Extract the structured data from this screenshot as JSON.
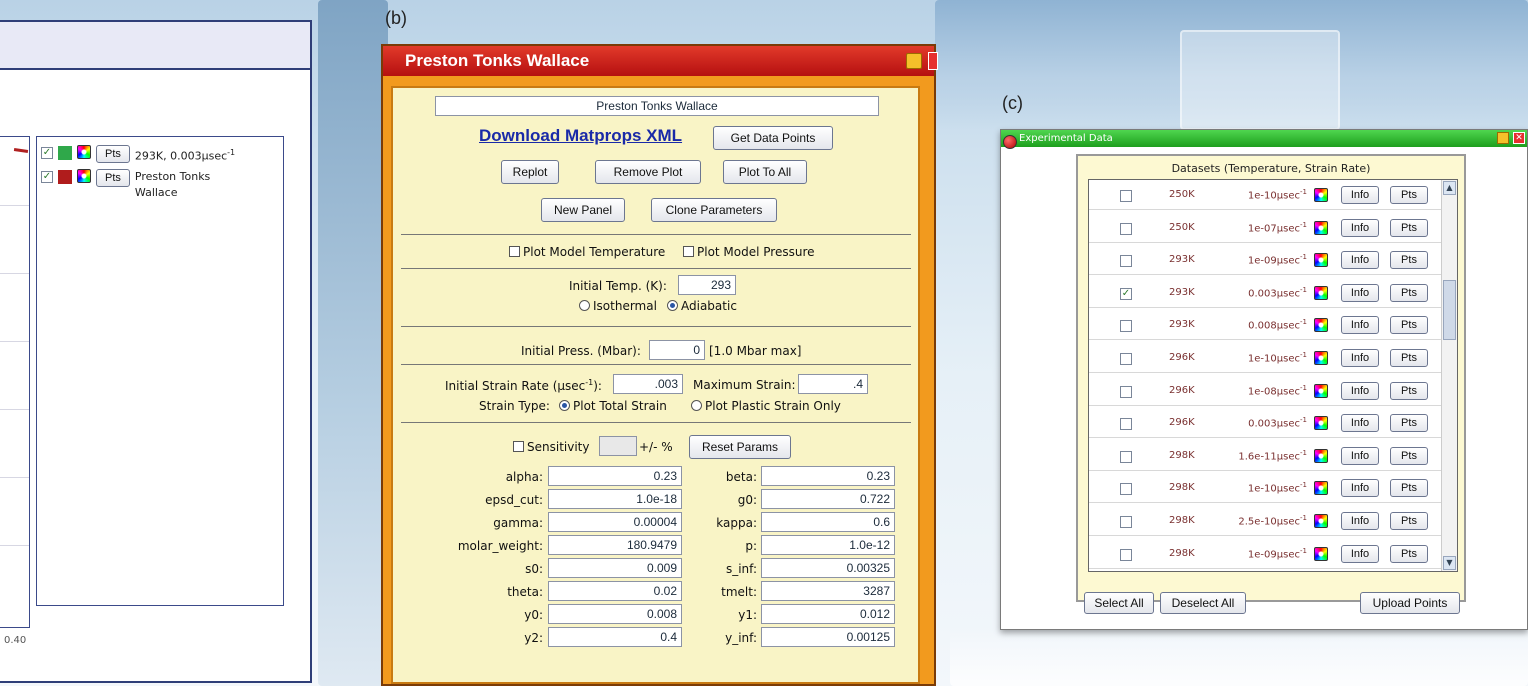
{
  "panel_labels": {
    "b": "(b)",
    "c": "(c)"
  },
  "panel_a": {
    "legend": [
      {
        "checked": true,
        "color": "#2fa84a",
        "pts_label": "Pts",
        "label": "293K, 0.003μsec",
        "sup": "-1"
      },
      {
        "checked": true,
        "color": "#b01c1c",
        "pts_label": "Pts",
        "label": "Preston Tonks Wallace",
        "sup": ""
      }
    ],
    "x_tick": "0.40"
  },
  "window_b": {
    "title": "Preston Tonks Wallace",
    "name_field": "Preston Tonks Wallace",
    "download_link": "Download Matprops XML",
    "buttons": {
      "get_data_points": "Get Data Points",
      "replot": "Replot",
      "remove_plot": "Remove Plot",
      "plot_to_all": "Plot To All",
      "new_panel": "New Panel",
      "clone_parameters": "Clone Parameters",
      "reset_params": "Reset Params"
    },
    "plot_model_temperature": "Plot Model Temperature",
    "plot_model_pressure": "Plot Model Pressure",
    "initial_temp_label": "Initial Temp. (K):",
    "initial_temp_value": "293",
    "isothermal": "Isothermal",
    "adiabatic": "Adiabatic",
    "initial_press_label": "Initial Press. (Mbar):",
    "initial_press_value": "0",
    "initial_press_max": "[1.0 Mbar max]",
    "strain_rate_label_pre": "Initial Strain Rate (μsec",
    "strain_rate_label_sup": "-1",
    "strain_rate_label_post": "):",
    "strain_rate_value": ".003",
    "max_strain_label": "Maximum Strain:",
    "max_strain_value": ".4",
    "strain_type_label": "Strain Type:",
    "plot_total_strain": "Plot Total Strain",
    "plot_plastic_strain": "Plot Plastic Strain Only",
    "sensitivity_label": "Sensitivity",
    "sensitivity_suffix": "+/- %",
    "params_left": [
      {
        "label": "alpha:",
        "value": "0.23"
      },
      {
        "label": "epsd_cut:",
        "value": "1.0e-18"
      },
      {
        "label": "gamma:",
        "value": "0.00004"
      },
      {
        "label": "molar_weight:",
        "value": "180.9479"
      },
      {
        "label": "s0:",
        "value": "0.009"
      },
      {
        "label": "theta:",
        "value": "0.02"
      },
      {
        "label": "y0:",
        "value": "0.008"
      },
      {
        "label": "y2:",
        "value": "0.4"
      }
    ],
    "params_right": [
      {
        "label": "beta:",
        "value": "0.23"
      },
      {
        "label": "g0:",
        "value": "0.722"
      },
      {
        "label": "kappa:",
        "value": "0.6"
      },
      {
        "label": "p:",
        "value": "1.0e-12"
      },
      {
        "label": "s_inf:",
        "value": "0.00325"
      },
      {
        "label": "tmelt:",
        "value": "3287"
      },
      {
        "label": "y1:",
        "value": "0.012"
      },
      {
        "label": "y_inf:",
        "value": "0.00125"
      }
    ]
  },
  "window_c": {
    "title": "Experimental Data",
    "header": "Datasets (Temperature, Strain Rate)",
    "info_label": "Info",
    "pts_label": "Pts",
    "rate_unit": "μsec",
    "rate_sup": "-1",
    "rows": [
      {
        "checked": false,
        "temp": "250K",
        "rate": "1e-10"
      },
      {
        "checked": false,
        "temp": "250K",
        "rate": "1e-07"
      },
      {
        "checked": false,
        "temp": "293K",
        "rate": "1e-09"
      },
      {
        "checked": true,
        "temp": "293K",
        "rate": "0.003"
      },
      {
        "checked": false,
        "temp": "293K",
        "rate": "0.008"
      },
      {
        "checked": false,
        "temp": "296K",
        "rate": "1e-10"
      },
      {
        "checked": false,
        "temp": "296K",
        "rate": "1e-08"
      },
      {
        "checked": false,
        "temp": "296K",
        "rate": "0.003"
      },
      {
        "checked": false,
        "temp": "298K",
        "rate": "1.6e-11"
      },
      {
        "checked": false,
        "temp": "298K",
        "rate": "1e-10"
      },
      {
        "checked": false,
        "temp": "298K",
        "rate": "2.5e-10"
      },
      {
        "checked": false,
        "temp": "298K",
        "rate": "1e-09"
      }
    ],
    "select_all": "Select All",
    "deselect_all": "Deselect All",
    "upload_points": "Upload Points"
  }
}
